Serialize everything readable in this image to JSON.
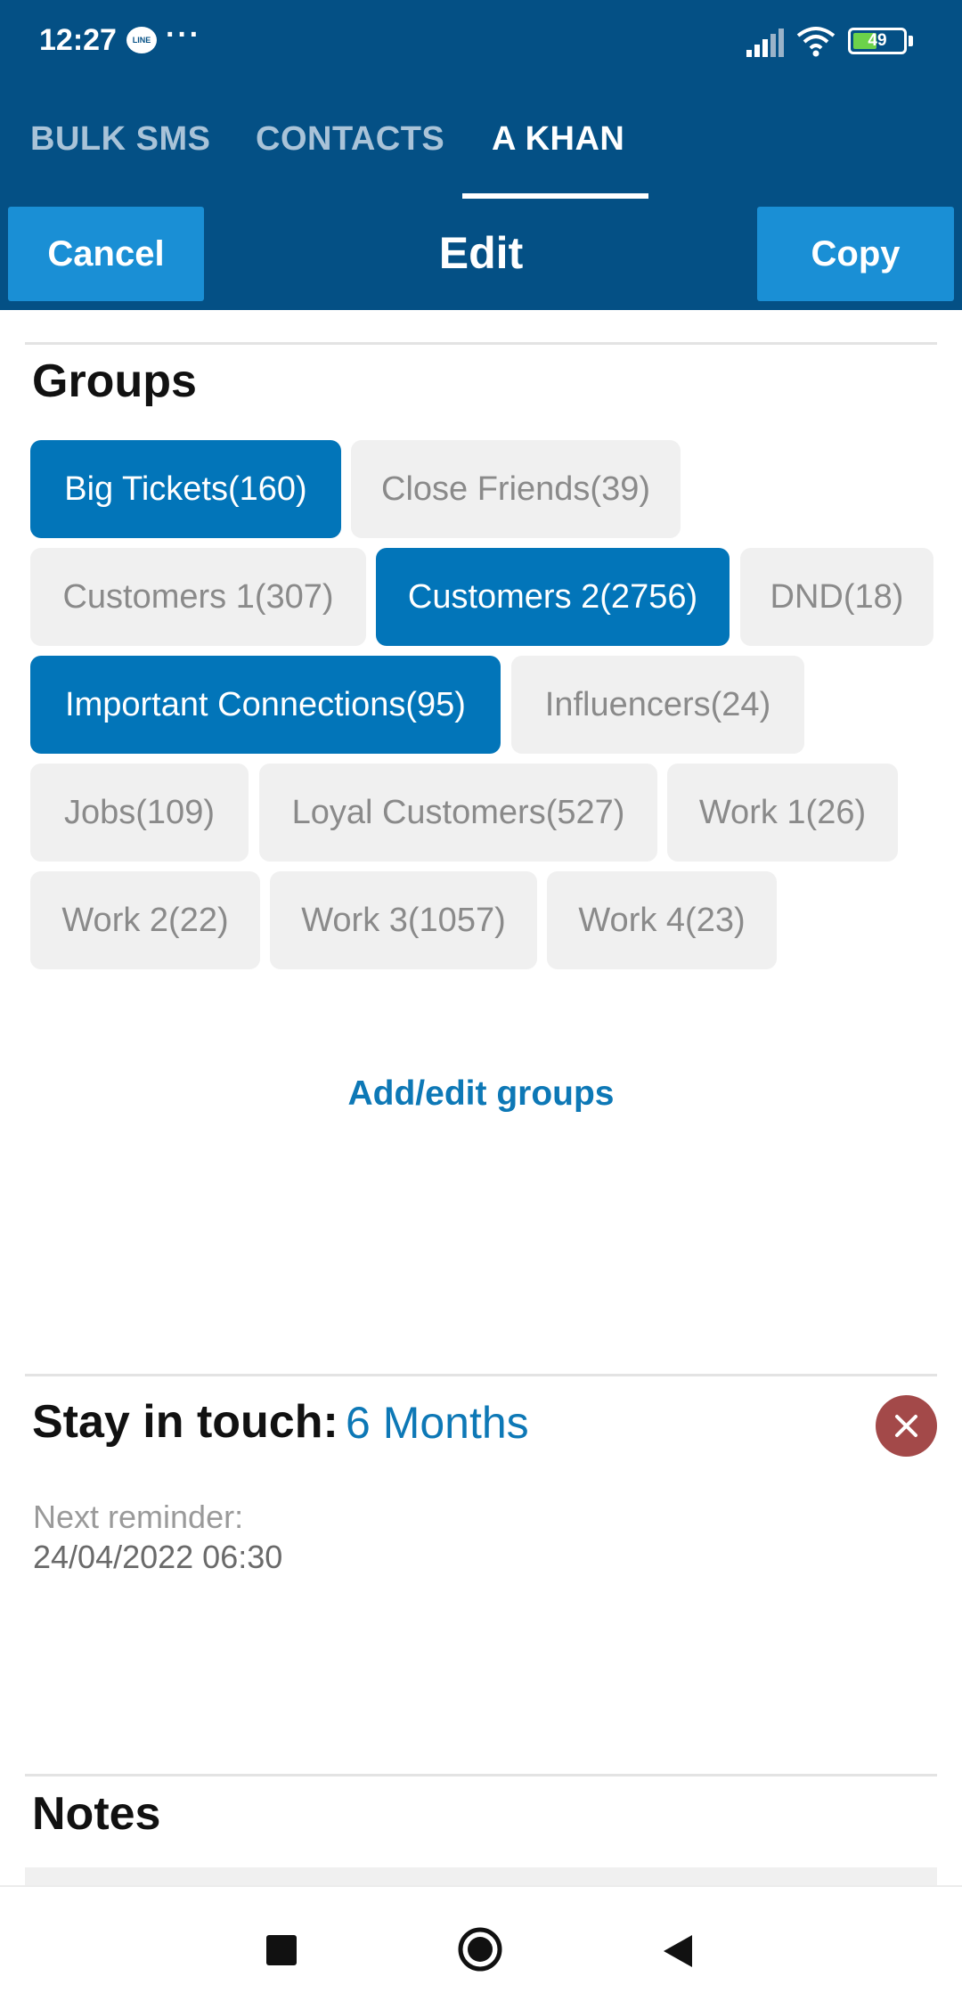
{
  "status_bar": {
    "time": "12:27",
    "dots": "···",
    "battery": "49",
    "icons": [
      "line-app-icon",
      "signal-icon",
      "wifi-icon",
      "battery-icon"
    ]
  },
  "tabs": [
    {
      "label": "BULK SMS",
      "active": false
    },
    {
      "label": "CONTACTS",
      "active": false
    },
    {
      "label": "A KHAN",
      "active": true
    }
  ],
  "edit_bar": {
    "cancel_label": "Cancel",
    "title": "Edit",
    "copy_label": "Copy"
  },
  "groups": {
    "title": "Groups",
    "chips": [
      {
        "label": "Big Tickets(160)",
        "selected": true
      },
      {
        "label": "Close Friends(39)",
        "selected": false
      },
      {
        "label": "Customers 1(307)",
        "selected": false
      },
      {
        "label": "Customers 2(2756)",
        "selected": true
      },
      {
        "label": "DND(18)",
        "selected": false
      },
      {
        "label": "Important Connections(95)",
        "selected": true
      },
      {
        "label": "Influencers(24)",
        "selected": false
      },
      {
        "label": "Jobs(109)",
        "selected": false
      },
      {
        "label": "Loyal Customers(527)",
        "selected": false
      },
      {
        "label": "Work 1(26)",
        "selected": false
      },
      {
        "label": "Work 2(22)",
        "selected": false
      },
      {
        "label": "Work 3(1057)",
        "selected": false
      },
      {
        "label": "Work 4(23)",
        "selected": false
      }
    ],
    "add_edit_label": "Add/edit groups"
  },
  "stay_in_touch": {
    "label": "Stay in touch:",
    "value": "6 Months",
    "next_reminder_label": "Next reminder:",
    "next_reminder_value": "24/04/2022 06:30"
  },
  "notes": {
    "title": "Notes"
  },
  "colors": {
    "header_bg": "#045085",
    "button_bg": "#1a8fd5",
    "chip_selected": "#0275b9",
    "chip_unselected": "#f0f0f0",
    "link": "#0d78b6",
    "remove": "#a34949"
  }
}
